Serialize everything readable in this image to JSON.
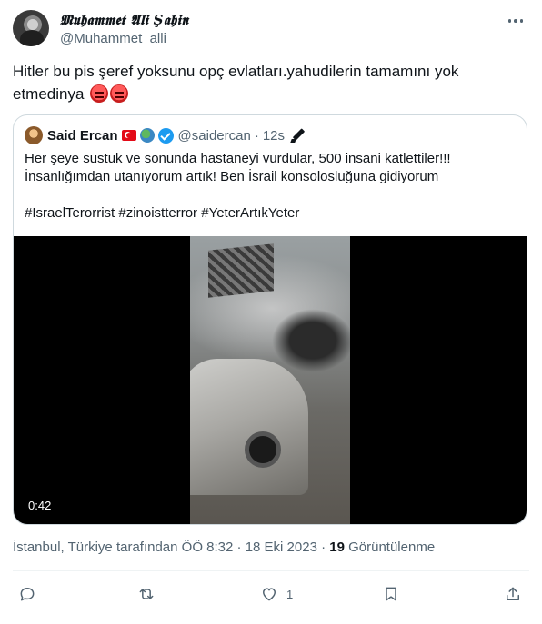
{
  "tweet": {
    "author": {
      "display_name": "𝕸𝖚𝖍𝖆𝖒𝖒𝖊𝖙 𝕬𝖑𝖎 Ş𝖆𝖍𝖎𝖓",
      "handle": "@Muhammet_alli"
    },
    "more_icon": "more-horizontal-icon",
    "text": "Hitler bu pis şeref yoksunu opç evlatları.yahudilerin tamamını yok etmedinya",
    "emojis": [
      "angry-face-emoji",
      "cursing-face-emoji"
    ],
    "quoted": {
      "display_name": "Said Ercan",
      "badges": [
        "turkey-flag-emoji",
        "globe-emoji",
        "verified-badge-icon"
      ],
      "handle": "@saidercan",
      "separator": "·",
      "time": "12s",
      "edit_icon": "pencil-icon",
      "text": "Her şeye sustuk ve sonunda hastaneyi vurdular, 500 insani katlettiler!!!\nİnsanlığımdan utanıyorum artık! Ben İsrail konsolosluğuna gidiyorum\n\n#IsraelTerorrist #zinoistterror #YeterArtıkYeter",
      "video": {
        "duration": "0:42"
      }
    },
    "meta": {
      "location_time": "İstanbul, Türkiye tarafından ÖÖ 8:32 · 18 Eki 2023 ·",
      "views_count": "19",
      "views_label": "Görüntülenme"
    },
    "actions": {
      "reply": {
        "icon": "reply-icon"
      },
      "retweet": {
        "icon": "retweet-icon"
      },
      "like": {
        "icon": "heart-icon",
        "count": "1"
      },
      "bookmark": {
        "icon": "bookmark-icon"
      },
      "share": {
        "icon": "share-icon"
      }
    },
    "colors": {
      "text": "#0f1419",
      "secondary": "#536471",
      "border": "#cfd9de",
      "verified": "#1d9bf0"
    }
  }
}
